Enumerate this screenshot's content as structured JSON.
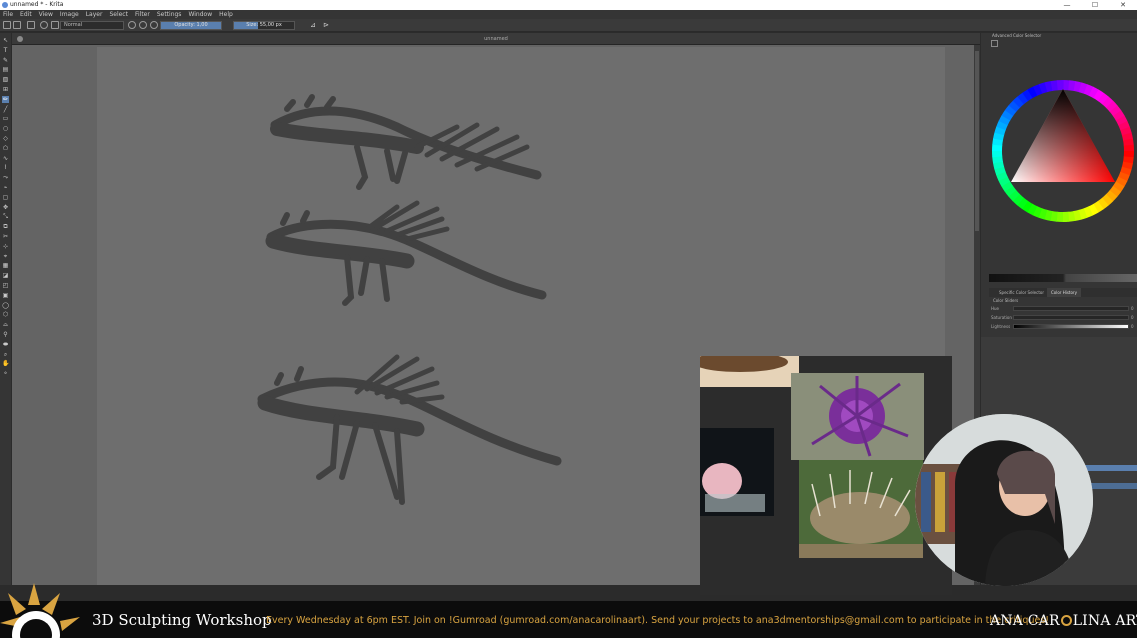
{
  "window": {
    "title": "unnamed * - Krita",
    "minimize": "—",
    "maximize": "☐",
    "close": "✕"
  },
  "menu": [
    "File",
    "Edit",
    "View",
    "Image",
    "Layer",
    "Select",
    "Filter",
    "Settings",
    "Window",
    "Help"
  ],
  "tool_options": {
    "blend_mode": "Normal",
    "opacity_label": "Opacity: 1,00",
    "opacity_value": 1.0,
    "size_label": "Size: 55,00 px",
    "size_value": 55.0,
    "mirror_h": "⊿",
    "mirror_v": "⊳"
  },
  "document": {
    "tab_title": "unnamed"
  },
  "docker": {
    "title": "Advanced Color Selector",
    "tabs": [
      "Specific Color Selector",
      "Color History"
    ],
    "hsl_title": "Color Sliders",
    "hsl": [
      {
        "label": "Hue",
        "value": "0"
      },
      {
        "label": "Saturation",
        "value": "0"
      },
      {
        "label": "Lightness",
        "value": "0"
      }
    ],
    "colors": {
      "accent": "#5a7fae"
    }
  },
  "banner": {
    "title": "3D Sculpting Workshop",
    "text": "Every Wednesday at 6pm EST. Join on !Gumroad (gumroad.com/anacarolinaart). Send your projects to ana3dmentorships@gmail.com to participate in the critiques!",
    "brand_left": "ANA CAR",
    "brand_right": "LINA ART",
    "accent": "#d9a441"
  }
}
